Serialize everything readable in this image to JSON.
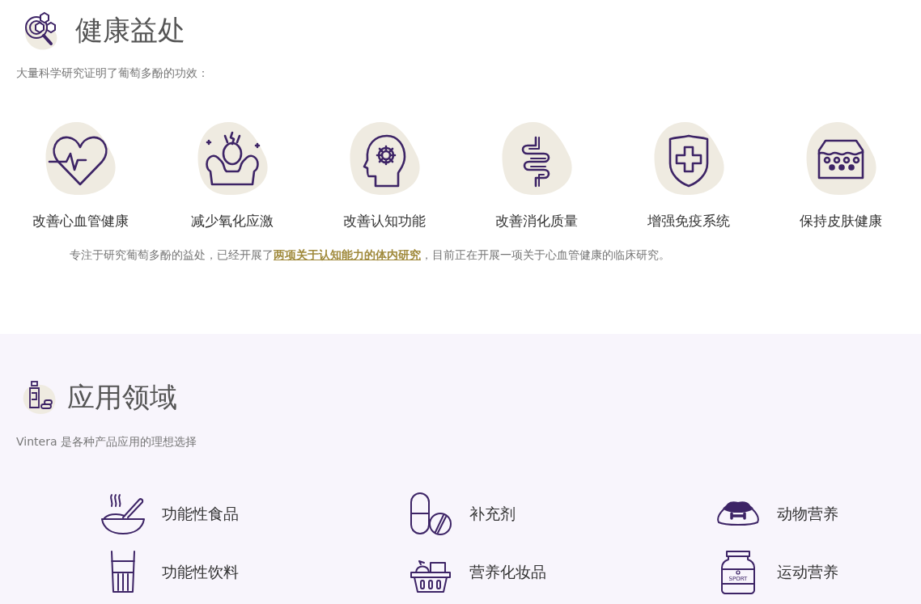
{
  "benefits": {
    "title": "健康益处",
    "intro": "大量科学研究证明了葡萄多酚的功效：",
    "items": [
      {
        "label": "改善心血管健康"
      },
      {
        "label": "减少氧化应激"
      },
      {
        "label": "改善认知功能"
      },
      {
        "label": "改善消化质量"
      },
      {
        "label": "增强免疫系统"
      },
      {
        "label": "保持皮肤健康"
      }
    ],
    "note": {
      "before": "专注于研究葡萄多酚的益处，已经开展了",
      "link": "两项关于认知能力的体内研究",
      "after": "，目前正在开展一项关于心血管健康的临床研究。"
    }
  },
  "applications": {
    "title": "应用领域",
    "intro": "Vintera 是各种产品应用的理想选择",
    "items": [
      {
        "label": "功能性食品"
      },
      {
        "label": "补充剂"
      },
      {
        "label": "动物营养"
      },
      {
        "label": "功能性饮料"
      },
      {
        "label": "营养化妆品"
      },
      {
        "label": "运动营养",
        "icon_text": "SPORT"
      }
    ]
  }
}
